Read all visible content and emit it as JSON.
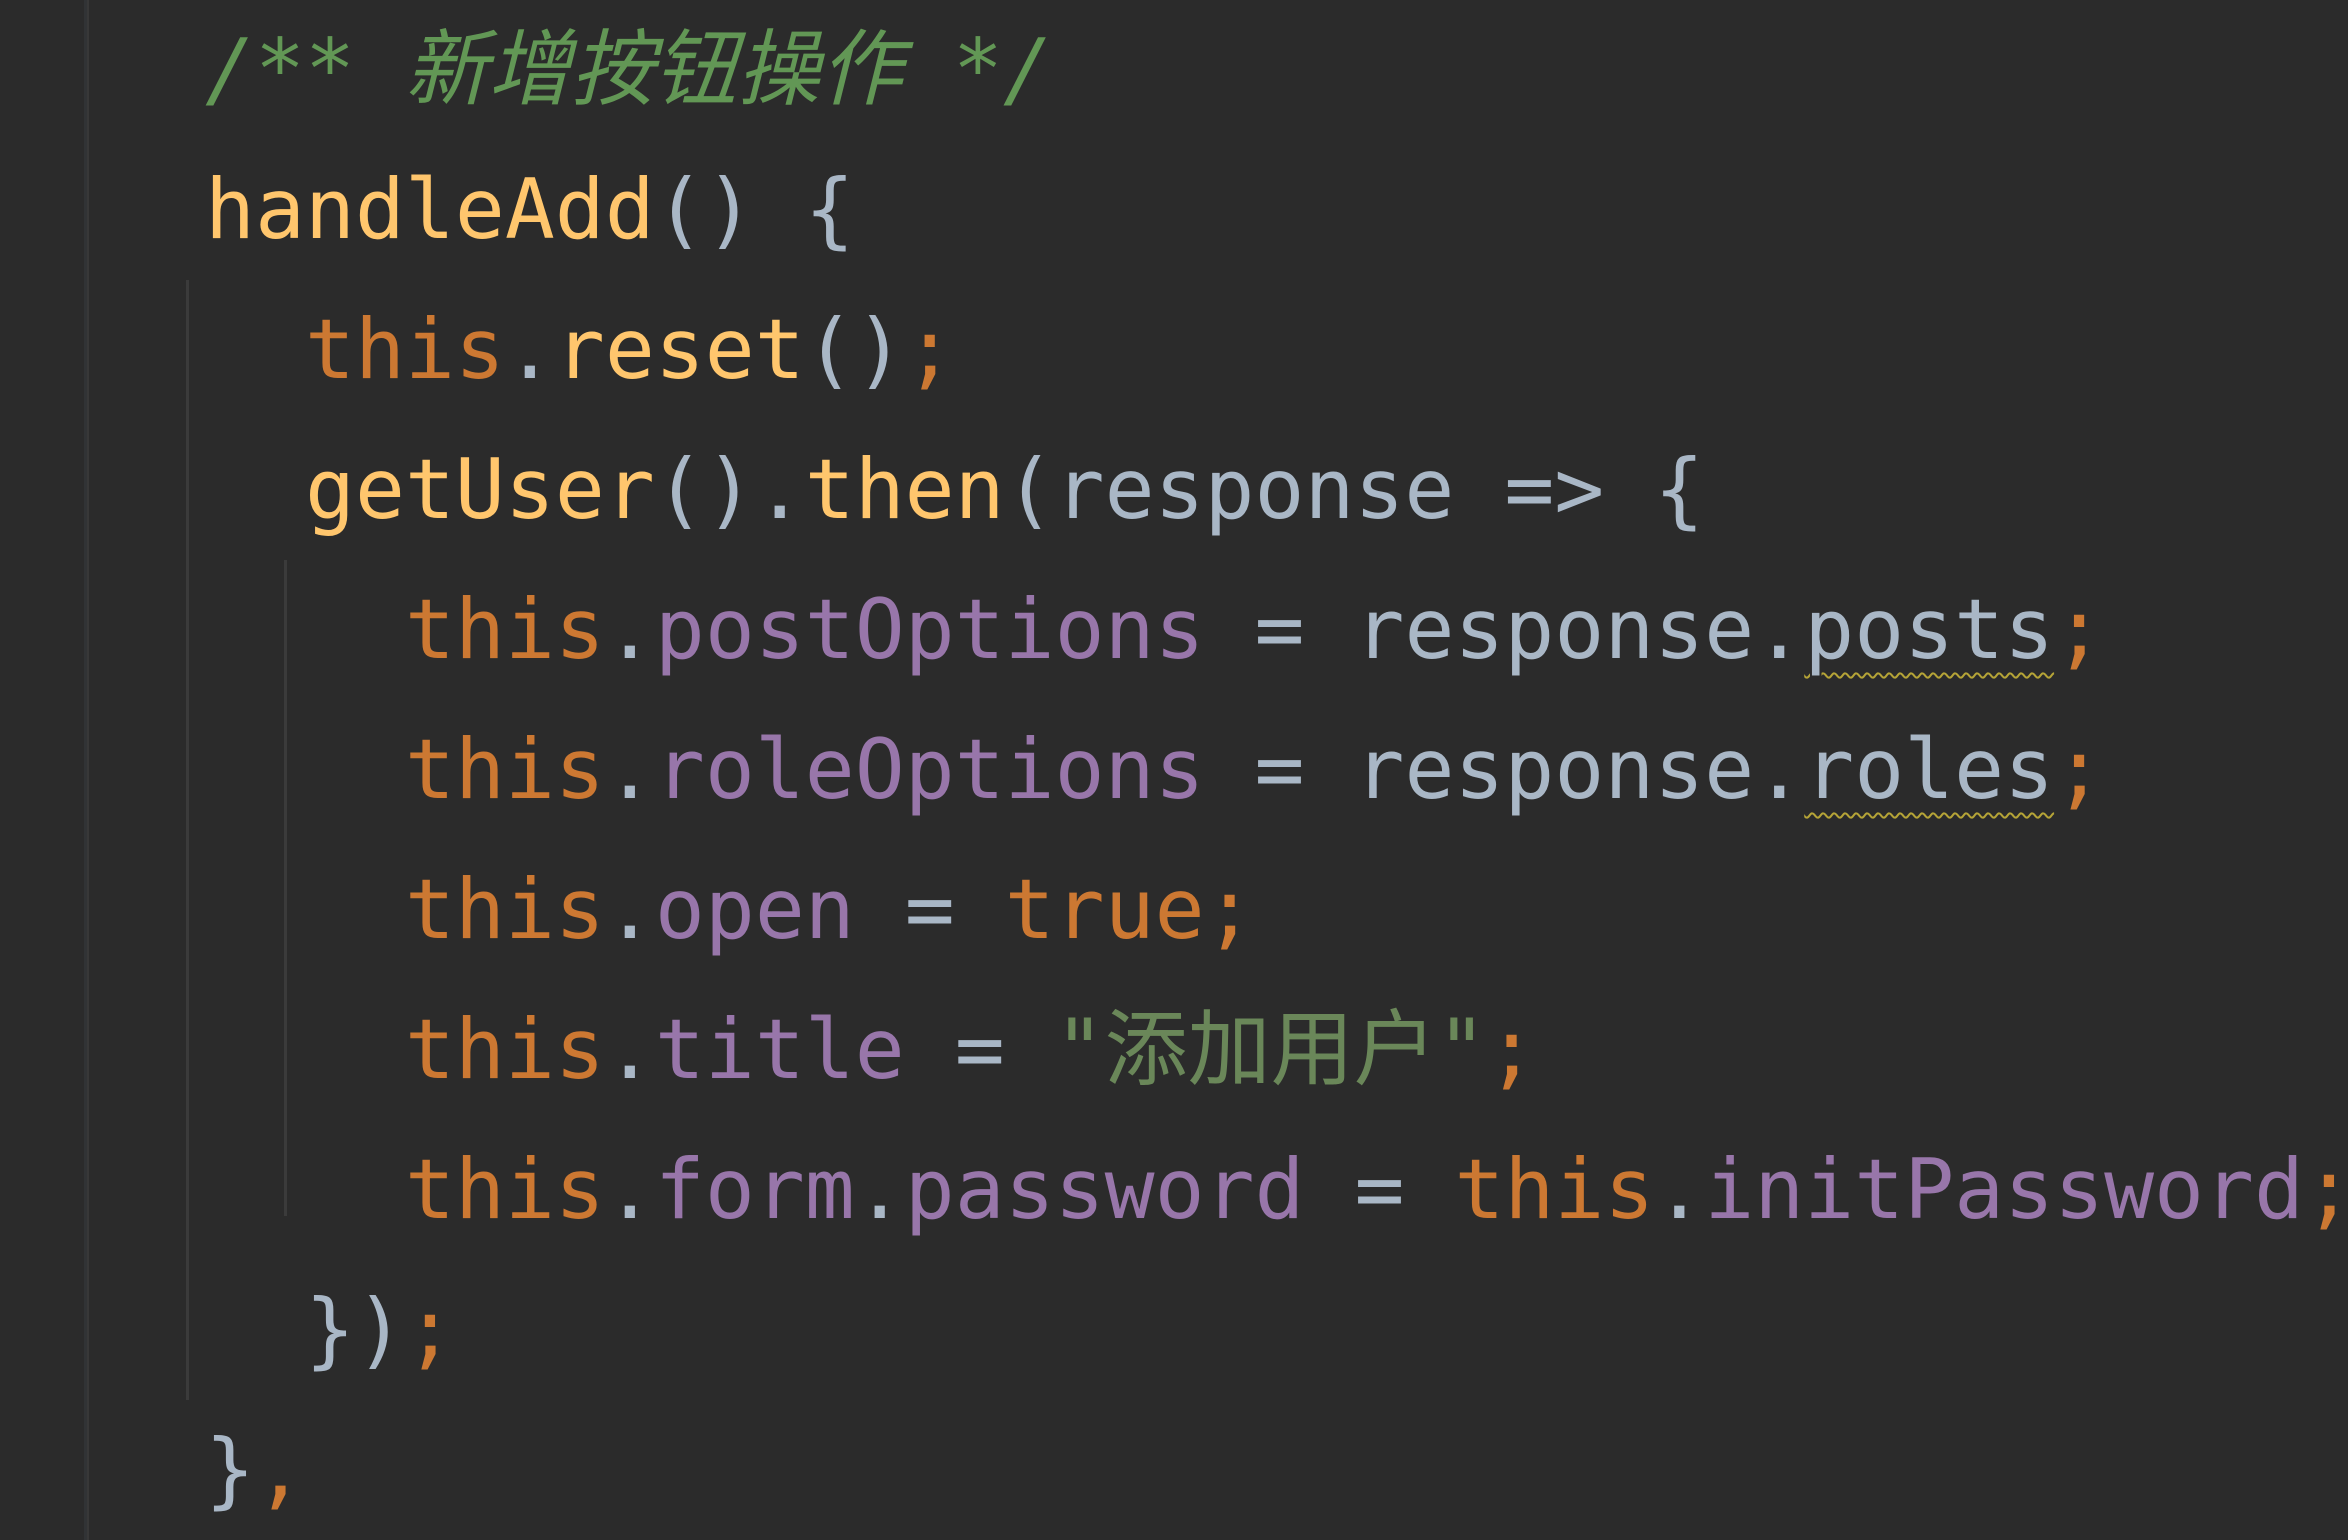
{
  "theme": {
    "background": "#2b2b2b",
    "comment": "#629755",
    "function": "#ffc66d",
    "keyword": "#cc7832",
    "property": "#9876aa",
    "identifier": "#a9b7c6",
    "string": "#6a8759",
    "warning_underline": "#b5a437"
  },
  "code": {
    "lines": [
      {
        "tokens": [
          {
            "t": "/** 新增按钮操作 */",
            "c": "comment"
          }
        ]
      },
      {
        "tokens": [
          {
            "t": "handleAdd",
            "c": "fn"
          },
          {
            "t": "() {",
            "c": "punc"
          }
        ]
      },
      {
        "tokens": [
          {
            "t": "this",
            "c": "kw"
          },
          {
            "t": ".",
            "c": "punc"
          },
          {
            "t": "reset",
            "c": "fn"
          },
          {
            "t": "()",
            "c": "punc"
          },
          {
            "t": ";",
            "c": "semi"
          }
        ]
      },
      {
        "tokens": [
          {
            "t": "getUser",
            "c": "fn"
          },
          {
            "t": "().",
            "c": "punc"
          },
          {
            "t": "then",
            "c": "fn"
          },
          {
            "t": "(",
            "c": "punc"
          },
          {
            "t": "response",
            "c": "ident"
          },
          {
            "t": " => {",
            "c": "punc"
          }
        ]
      },
      {
        "tokens": [
          {
            "t": "this",
            "c": "kw"
          },
          {
            "t": ".",
            "c": "punc"
          },
          {
            "t": "postOptions",
            "c": "prop"
          },
          {
            "t": " = ",
            "c": "punc"
          },
          {
            "t": "response",
            "c": "ident"
          },
          {
            "t": ".",
            "c": "punc"
          },
          {
            "t": "posts",
            "c": "ident",
            "warn": true
          },
          {
            "t": ";",
            "c": "semi"
          }
        ]
      },
      {
        "tokens": [
          {
            "t": "this",
            "c": "kw"
          },
          {
            "t": ".",
            "c": "punc"
          },
          {
            "t": "roleOptions",
            "c": "prop"
          },
          {
            "t": " = ",
            "c": "punc"
          },
          {
            "t": "response",
            "c": "ident"
          },
          {
            "t": ".",
            "c": "punc"
          },
          {
            "t": "roles",
            "c": "ident",
            "warn": true
          },
          {
            "t": ";",
            "c": "semi"
          }
        ]
      },
      {
        "tokens": [
          {
            "t": "this",
            "c": "kw"
          },
          {
            "t": ".",
            "c": "punc"
          },
          {
            "t": "open",
            "c": "prop"
          },
          {
            "t": " = ",
            "c": "punc"
          },
          {
            "t": "true",
            "c": "kw"
          },
          {
            "t": ";",
            "c": "semi"
          }
        ]
      },
      {
        "tokens": [
          {
            "t": "this",
            "c": "kw"
          },
          {
            "t": ".",
            "c": "punc"
          },
          {
            "t": "title",
            "c": "prop"
          },
          {
            "t": " = ",
            "c": "punc"
          },
          {
            "t": "\"添加用户\"",
            "c": "str"
          },
          {
            "t": ";",
            "c": "semi"
          }
        ]
      },
      {
        "tokens": [
          {
            "t": "this",
            "c": "kw"
          },
          {
            "t": ".",
            "c": "punc"
          },
          {
            "t": "form",
            "c": "prop"
          },
          {
            "t": ".",
            "c": "punc"
          },
          {
            "t": "password",
            "c": "prop"
          },
          {
            "t": " = ",
            "c": "punc"
          },
          {
            "t": "this",
            "c": "kw"
          },
          {
            "t": ".",
            "c": "punc"
          },
          {
            "t": "initPassword",
            "c": "prop"
          },
          {
            "t": ";",
            "c": "semi"
          }
        ]
      },
      {
        "tokens": [
          {
            "t": "})",
            "c": "punc"
          },
          {
            "t": ";",
            "c": "semi"
          }
        ]
      },
      {
        "tokens": [
          {
            "t": "}",
            "c": "punc"
          },
          {
            "t": ",",
            "c": "semi"
          }
        ]
      }
    ]
  }
}
